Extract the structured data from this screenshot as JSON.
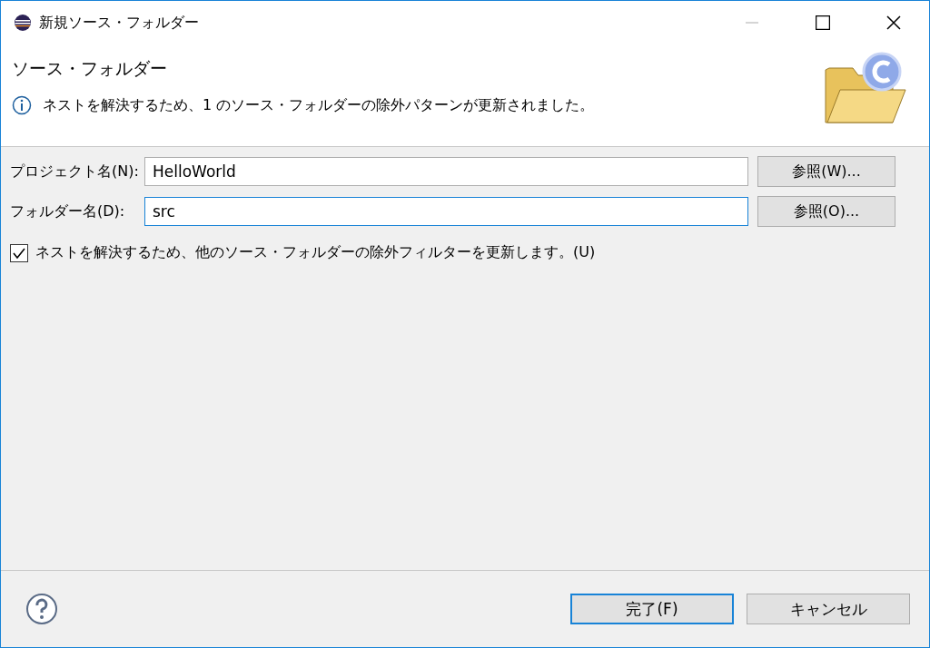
{
  "window": {
    "title": "新規ソース・フォルダー"
  },
  "header": {
    "title": "ソース・フォルダー",
    "message": "ネストを解決するため、1 のソース・フォルダーの除外パターンが更新されました。"
  },
  "fields": [
    {
      "label": "プロジェクト名(N):",
      "value": "HelloWorld",
      "focused": false,
      "button": "参照(W)..."
    },
    {
      "label": "フォルダー名(D):",
      "value": "src",
      "focused": true,
      "button": "参照(O)..."
    }
  ],
  "option": {
    "label": "ネストを解決するため、他のソース・フォルダーの除外フィルターを更新します。(U)",
    "checked": true
  },
  "buttons": [
    {
      "label": "完了(F)",
      "default": true
    },
    {
      "label": "キャンセル",
      "default": false
    }
  ]
}
